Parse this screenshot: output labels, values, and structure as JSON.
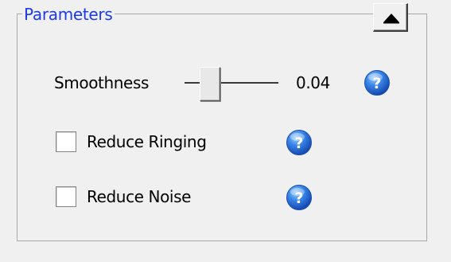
{
  "parameters": {
    "title": "Parameters",
    "collapse_icon": "up-triangle-icon",
    "smoothness": {
      "label": "Smoothness",
      "value_text": "0.04",
      "help_icon": "question-mark-icon"
    },
    "reduce_ringing": {
      "label": "Reduce Ringing",
      "checked": false,
      "help_icon": "question-mark-icon"
    },
    "reduce_noise": {
      "label": "Reduce Noise",
      "checked": false,
      "help_icon": "question-mark-icon"
    }
  },
  "colors": {
    "title": "#1c3ae8",
    "help_icon_blue": "#2a6fd8"
  }
}
